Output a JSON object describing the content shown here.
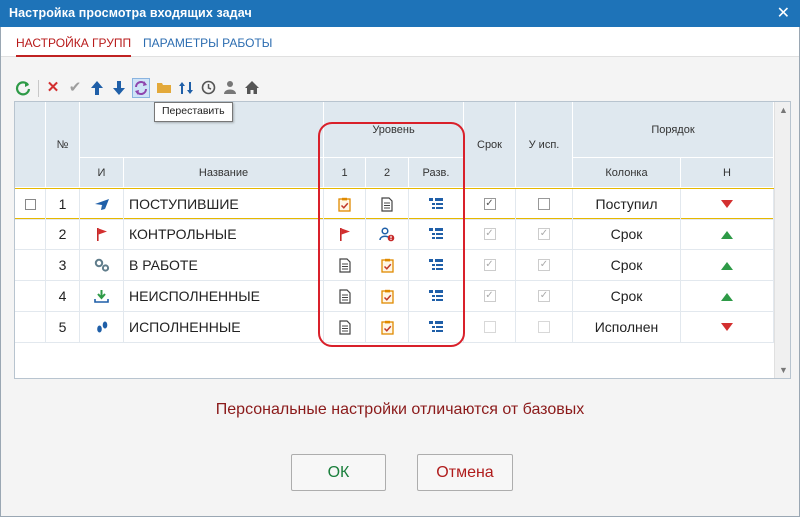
{
  "window": {
    "title": "Настройка просмотра входящих задач",
    "close_icon": "close-icon"
  },
  "tabs": [
    {
      "label": "НАСТРОЙКА ГРУПП",
      "active": true
    },
    {
      "label": "ПАРАМЕТРЫ РАБОТЫ",
      "active": false
    }
  ],
  "toolbar": {
    "tooltip": "Переставить",
    "icons": [
      "refresh-icon",
      "delete-icon",
      "check-icon",
      "arrow-up-icon",
      "arrow-down-icon",
      "reorder-icon",
      "folder-icon",
      "sort-icon",
      "clock-icon",
      "users-icon",
      "home-icon"
    ]
  },
  "grid": {
    "headers": {
      "number": "№",
      "icon": "И",
      "name": "Название",
      "level": "Уровень",
      "level_1": "1",
      "level_2": "2",
      "level_expand": "Разв.",
      "deadline": "Срок",
      "executor": "У исп.",
      "order": "Порядок",
      "order_column": "Колонка",
      "order_dir": "Н"
    },
    "rows": [
      {
        "num": "1",
        "icon": "plane-icon",
        "name": "ПОСТУПИВШИЕ",
        "level1": "task-check-icon",
        "level2": "document-icon",
        "deadline": true,
        "deadline_enabled": true,
        "executor": false,
        "executor_enabled": true,
        "column": "Поступил",
        "direction": "down"
      },
      {
        "num": "2",
        "icon": "flag-icon",
        "name": "КОНТРОЛЬНЫЕ",
        "level1": "flag-icon",
        "level2": "user-alert-icon",
        "deadline": true,
        "deadline_enabled": false,
        "executor": true,
        "executor_enabled": false,
        "column": "Срок",
        "direction": "up"
      },
      {
        "num": "3",
        "icon": "gears-icon",
        "name": "В РАБОТЕ",
        "level1": "document-icon",
        "level2": "task-check-icon",
        "deadline": true,
        "deadline_enabled": false,
        "executor": true,
        "executor_enabled": false,
        "column": "Срок",
        "direction": "up"
      },
      {
        "num": "4",
        "icon": "download-icon",
        "name": "НЕИСПОЛНЕННЫЕ",
        "level1": "document-icon",
        "level2": "task-check-icon",
        "deadline": true,
        "deadline_enabled": false,
        "executor": true,
        "executor_enabled": false,
        "column": "Срок",
        "direction": "up"
      },
      {
        "num": "5",
        "icon": "footprints-icon",
        "name": "ИСПОЛНЕННЫЕ",
        "level1": "document-icon",
        "level2": "task-check-icon",
        "deadline": false,
        "deadline_enabled": false,
        "executor": false,
        "executor_enabled": false,
        "column": "Исполнен",
        "direction": "down"
      }
    ]
  },
  "message": "Персональные настройки отличаются от базовых",
  "buttons": {
    "ok": "ОК",
    "cancel": "Отмена"
  },
  "colors": {
    "titlebar": "#1e73b8",
    "accent_red": "#c02222",
    "ok_green": "#1a7f3c",
    "header_bg": "#dfe8ef",
    "highlight": "#d9202a"
  }
}
